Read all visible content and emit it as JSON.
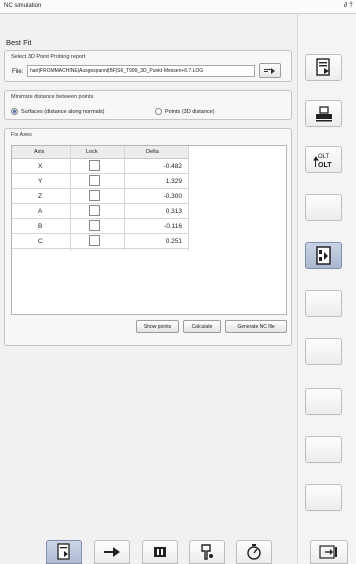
{
  "window": {
    "title": "NC simulation",
    "controls": "∂ †"
  },
  "page": {
    "title": "Best Fit"
  },
  "report": {
    "legend": "Select 3D Point Probing report",
    "file_label": "File:",
    "file_value": "hart|FROMMACHINE|Ausgespannt|BF|S6_T999_3D_Punkt-Messen+6.7.LOG"
  },
  "minimize": {
    "legend": "Minimize distance between points",
    "options": [
      {
        "label": "Surfaces (distance along normals)",
        "selected": true
      },
      {
        "label": "Points (3D distance)",
        "selected": false
      }
    ]
  },
  "fix_axes": {
    "legend": "Fix Axes",
    "columns": [
      "Axis",
      "Lock",
      "Delta"
    ],
    "rows": [
      {
        "axis": "X",
        "lock": false,
        "delta": "-0.482"
      },
      {
        "axis": "Y",
        "lock": false,
        "delta": "1.329"
      },
      {
        "axis": "Z",
        "lock": false,
        "delta": "-0.300"
      },
      {
        "axis": "A",
        "lock": false,
        "delta": "0.313"
      },
      {
        "axis": "B",
        "lock": false,
        "delta": "-0.116"
      },
      {
        "axis": "C",
        "lock": false,
        "delta": "0.251"
      }
    ]
  },
  "actions": {
    "show_points": "Show points",
    "calculate": "Calculate",
    "generate": "Generate NC file"
  },
  "side_icons": {
    "report": "report-icon",
    "probe": "probe-icon",
    "ok": "ok-icon",
    "bestfit": "best-fit-icon"
  },
  "side_text": {
    "ok_top": "дОЦ",
    "ok_bottom": "⚓ОЦ"
  },
  "colors": {
    "accent": "#aab8d0",
    "border": "#bdbdbd"
  }
}
